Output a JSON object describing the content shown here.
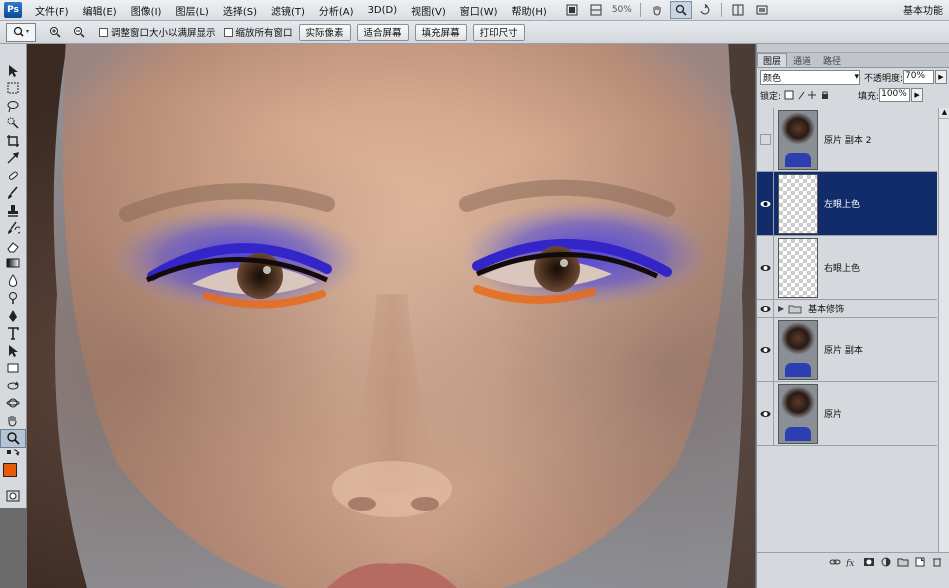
{
  "app": {
    "logo": "Ps",
    "workspace": "基本功能",
    "zoom": "50%"
  },
  "menu": [
    "文件(F)",
    "编辑(E)",
    "图像(I)",
    "图层(L)",
    "选择(S)",
    "滤镜(T)",
    "分析(A)",
    "3D(D)",
    "视图(V)",
    "窗口(W)",
    "帮助(H)"
  ],
  "options": {
    "resize_windows_label": "调整窗口大小以满屏显示",
    "zoom_all_label": "缩放所有窗口",
    "actual_pixels": "实际像素",
    "fit_screen": "适合屏幕",
    "fill_screen": "填充屏幕",
    "print_size": "打印尺寸"
  },
  "layers_panel": {
    "tabs": [
      "图层",
      "通道",
      "路径"
    ],
    "blend_mode": "颜色",
    "opacity_label": "不透明度:",
    "opacity_value": "70%",
    "lock_label": "锁定:",
    "fill_label": "填充:",
    "fill_value": "100%",
    "layers": [
      {
        "name": "原片 副本 2",
        "visible": false,
        "thumb": "photo",
        "selected": false
      },
      {
        "name": "左眼上色",
        "visible": true,
        "thumb": "transparent",
        "selected": true
      },
      {
        "name": "右眼上色",
        "visible": true,
        "thumb": "transparent",
        "selected": false
      },
      {
        "name": "基本修饰",
        "visible": true,
        "thumb": "group",
        "selected": false
      },
      {
        "name": "原片 副本",
        "visible": true,
        "thumb": "photo",
        "selected": false
      },
      {
        "name": "原片",
        "visible": true,
        "thumb": "photo",
        "selected": false
      }
    ]
  },
  "colors": {
    "foreground": "#e85b06",
    "background": "#1010d8",
    "selection": "#112b6b"
  }
}
